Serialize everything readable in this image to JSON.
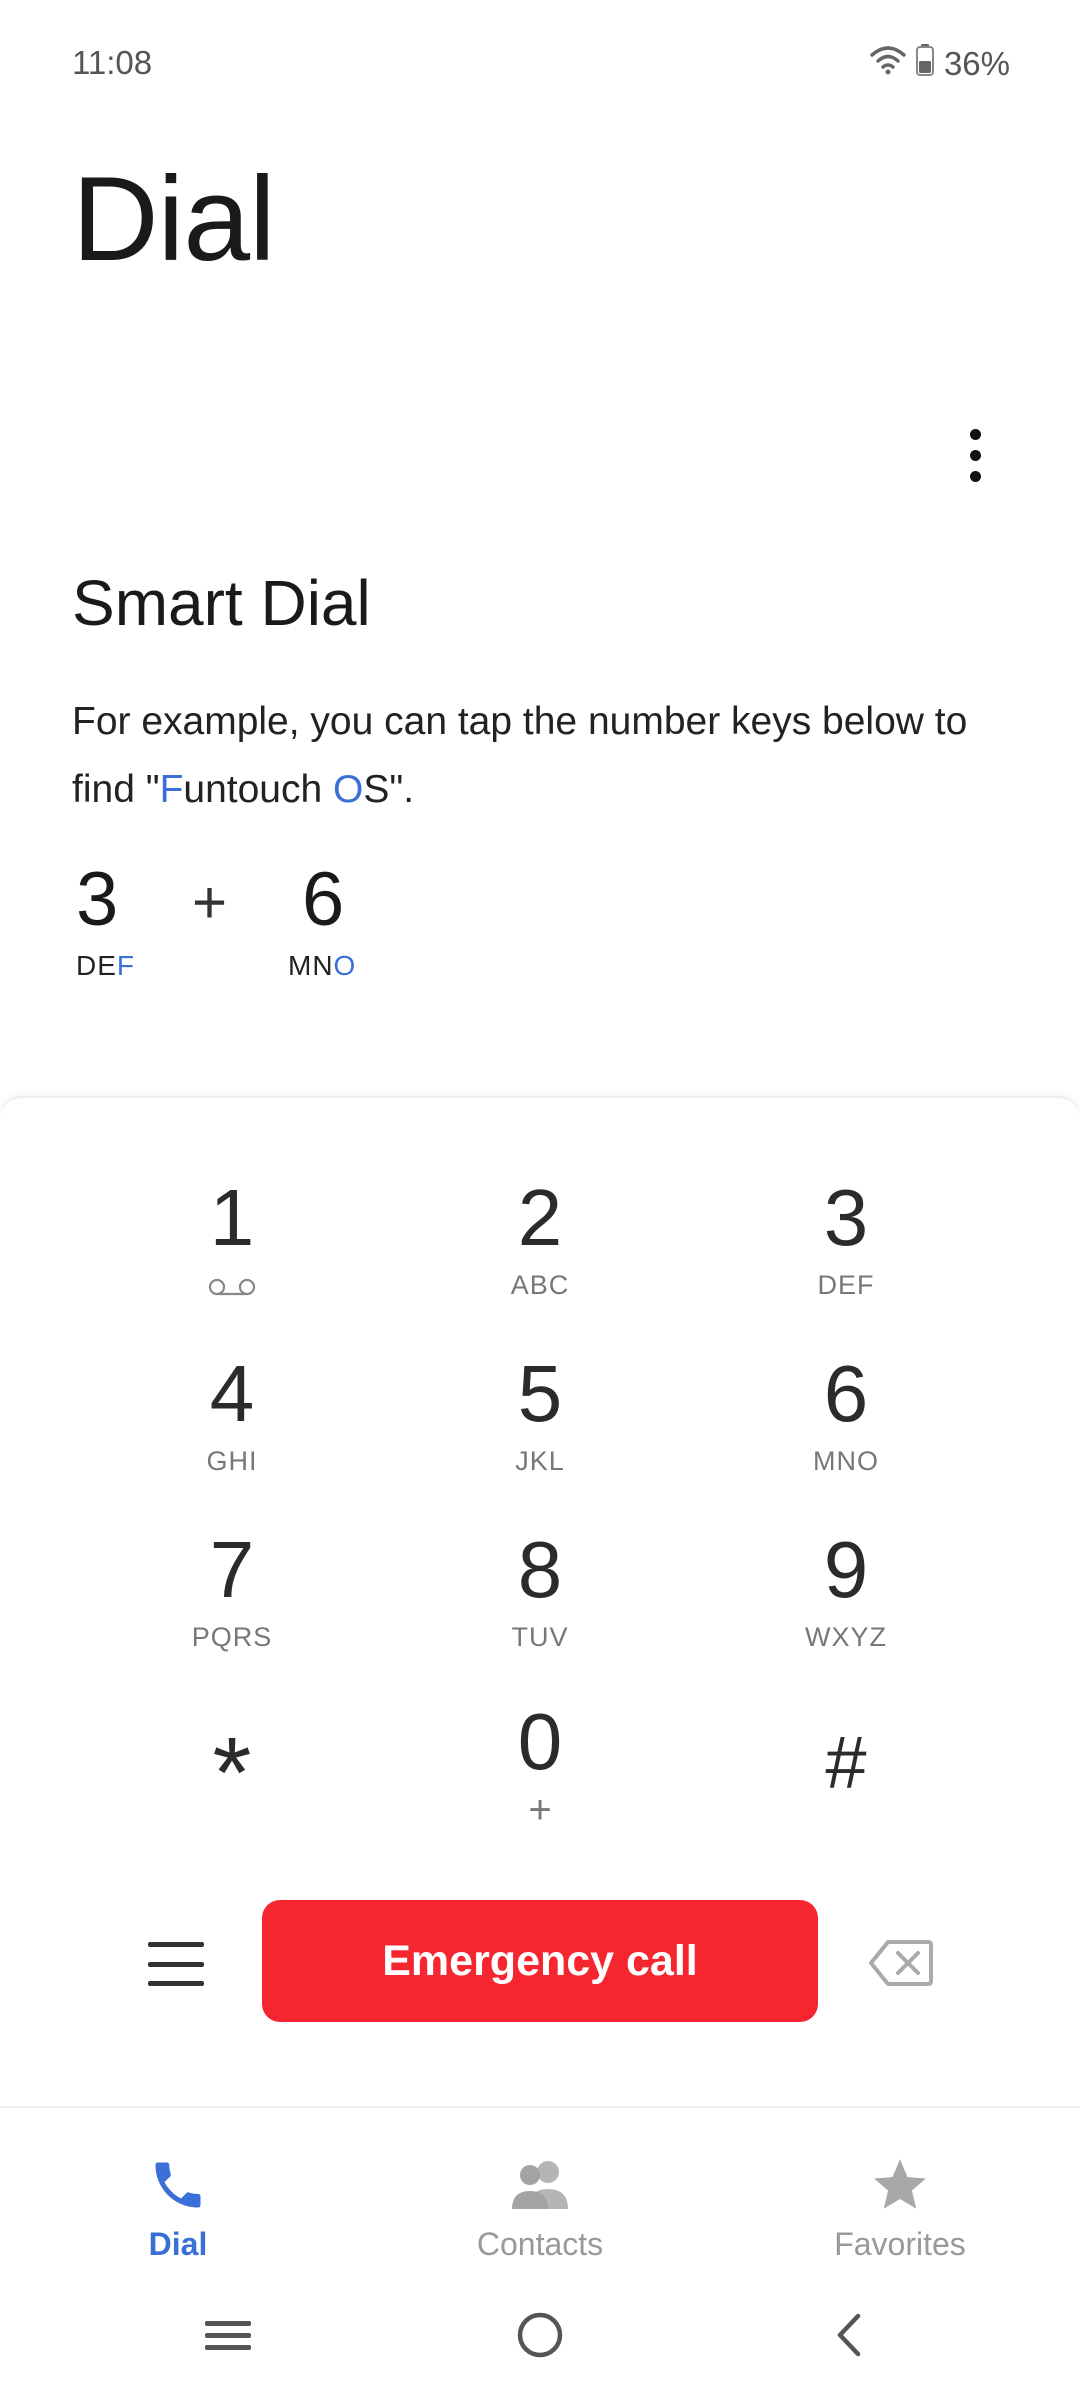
{
  "status_bar": {
    "time": "11:08",
    "battery": "36%",
    "icons": [
      "wifi-icon",
      "battery-icon"
    ]
  },
  "header": {
    "title": "Dial",
    "more_icon": "more-vertical-icon"
  },
  "smart_dial": {
    "title": "Smart Dial",
    "line1": "For example, you can tap the number keys below to",
    "line2_prefix": "find \"",
    "line2_f": "F",
    "line2_mid": "untouch ",
    "line2_o": "O",
    "line2_suffix": "S\".",
    "example": {
      "key1_digit": "3",
      "key1_letters_plain": "DE",
      "key1_letters_highlight": "F",
      "plus": "+",
      "key2_digit": "6",
      "key2_letters_plain": "MN",
      "key2_letters_highlight": "O"
    },
    "highlight_color": "#3b6fd8"
  },
  "keypad": {
    "keys": [
      {
        "digit": "1",
        "sub": ""
      },
      {
        "digit": "2",
        "sub": "ABC"
      },
      {
        "digit": "3",
        "sub": "DEF"
      },
      {
        "digit": "4",
        "sub": "GHI"
      },
      {
        "digit": "5",
        "sub": "JKL"
      },
      {
        "digit": "6",
        "sub": "MNO"
      },
      {
        "digit": "7",
        "sub": "PQRS"
      },
      {
        "digit": "8",
        "sub": "TUV"
      },
      {
        "digit": "9",
        "sub": "WXYZ"
      },
      {
        "digit": "*",
        "sub": ""
      },
      {
        "digit": "0",
        "sub": "+"
      },
      {
        "digit": "#",
        "sub": ""
      }
    ]
  },
  "actions": {
    "menu_icon": "menu-icon",
    "emergency_label": "Emergency call",
    "emergency_color": "#f5262f",
    "backspace_icon": "backspace-icon"
  },
  "bottom_nav": {
    "items": [
      {
        "label": "Dial",
        "icon": "phone-icon",
        "active": true
      },
      {
        "label": "Contacts",
        "icon": "contacts-icon",
        "active": false
      },
      {
        "label": "Favorites",
        "icon": "star-icon",
        "active": false
      }
    ],
    "active_color": "#3b6fd8",
    "inactive_color": "#999999"
  },
  "system_nav": {
    "icons": [
      "recents-icon",
      "home-icon",
      "back-icon"
    ]
  }
}
